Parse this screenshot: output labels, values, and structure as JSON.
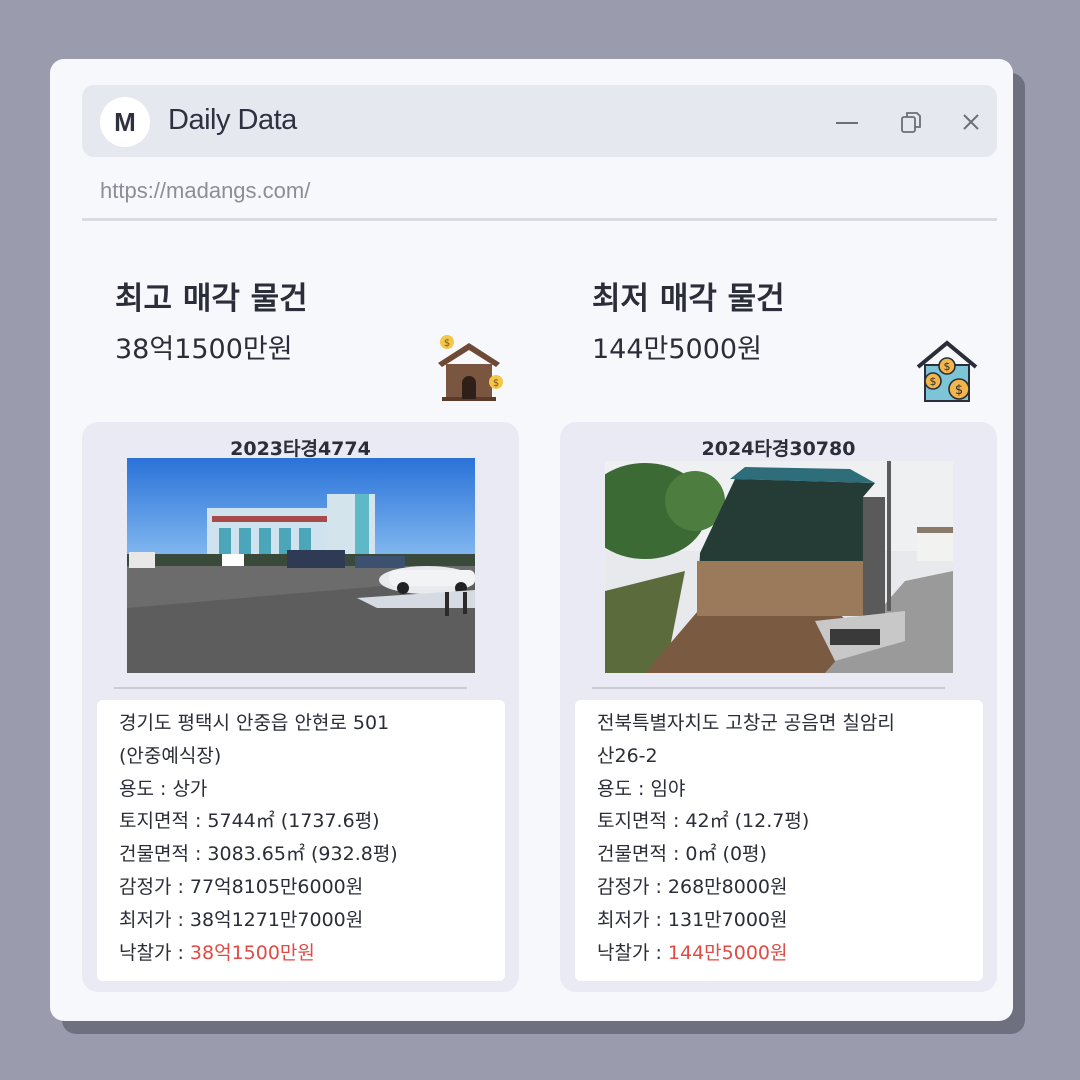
{
  "window": {
    "logo_letter": "M",
    "title": "Daily Data",
    "url": "https://madangs.com/",
    "buttons": [
      "minimize-icon",
      "copy-icon",
      "close-icon"
    ]
  },
  "highest": {
    "heading": "최고 매각 물건",
    "amount": "38억1500만원",
    "icon": "house-money-icon",
    "case_no": "2023타경4774",
    "address_line1": "경기도 평택시 안중읍 안현로 501",
    "address_line2": "(안중예식장)",
    "usage": "용도 : 상가",
    "land_area": "토지면적 : 5744㎡ (1737.6평)",
    "building_area": "건물면적 : 3083.65㎡ (932.8평)",
    "appraised": "감정가 : 77억8105만6000원",
    "minimum": "최저가 : 38억1271만7000원",
    "winning_label": "낙찰가 : ",
    "winning_value": "38억1500만원"
  },
  "lowest": {
    "heading": "최저 매각 물건",
    "amount": "144만5000원",
    "icon": "house-coins-icon",
    "case_no": "2024타경30780",
    "address_line1": "전북특별자치도 고창군 공음면 칠암리",
    "address_line2": "산26-2",
    "usage": "용도 :  임야",
    "land_area": "토지면적 :  42㎡ (12.7평)",
    "building_area": "건물면적 : 0㎡ (0평)",
    "appraised": "감정가 : 268만8000원",
    "minimum": "최저가 : 131만7000원",
    "winning_label": "낙찰가 : ",
    "winning_value": "144만5000원"
  },
  "colors": {
    "background": "#9a9cad",
    "window": "#f7f8fc",
    "card": "#e9eaf4",
    "accent_red": "#e24a45"
  }
}
